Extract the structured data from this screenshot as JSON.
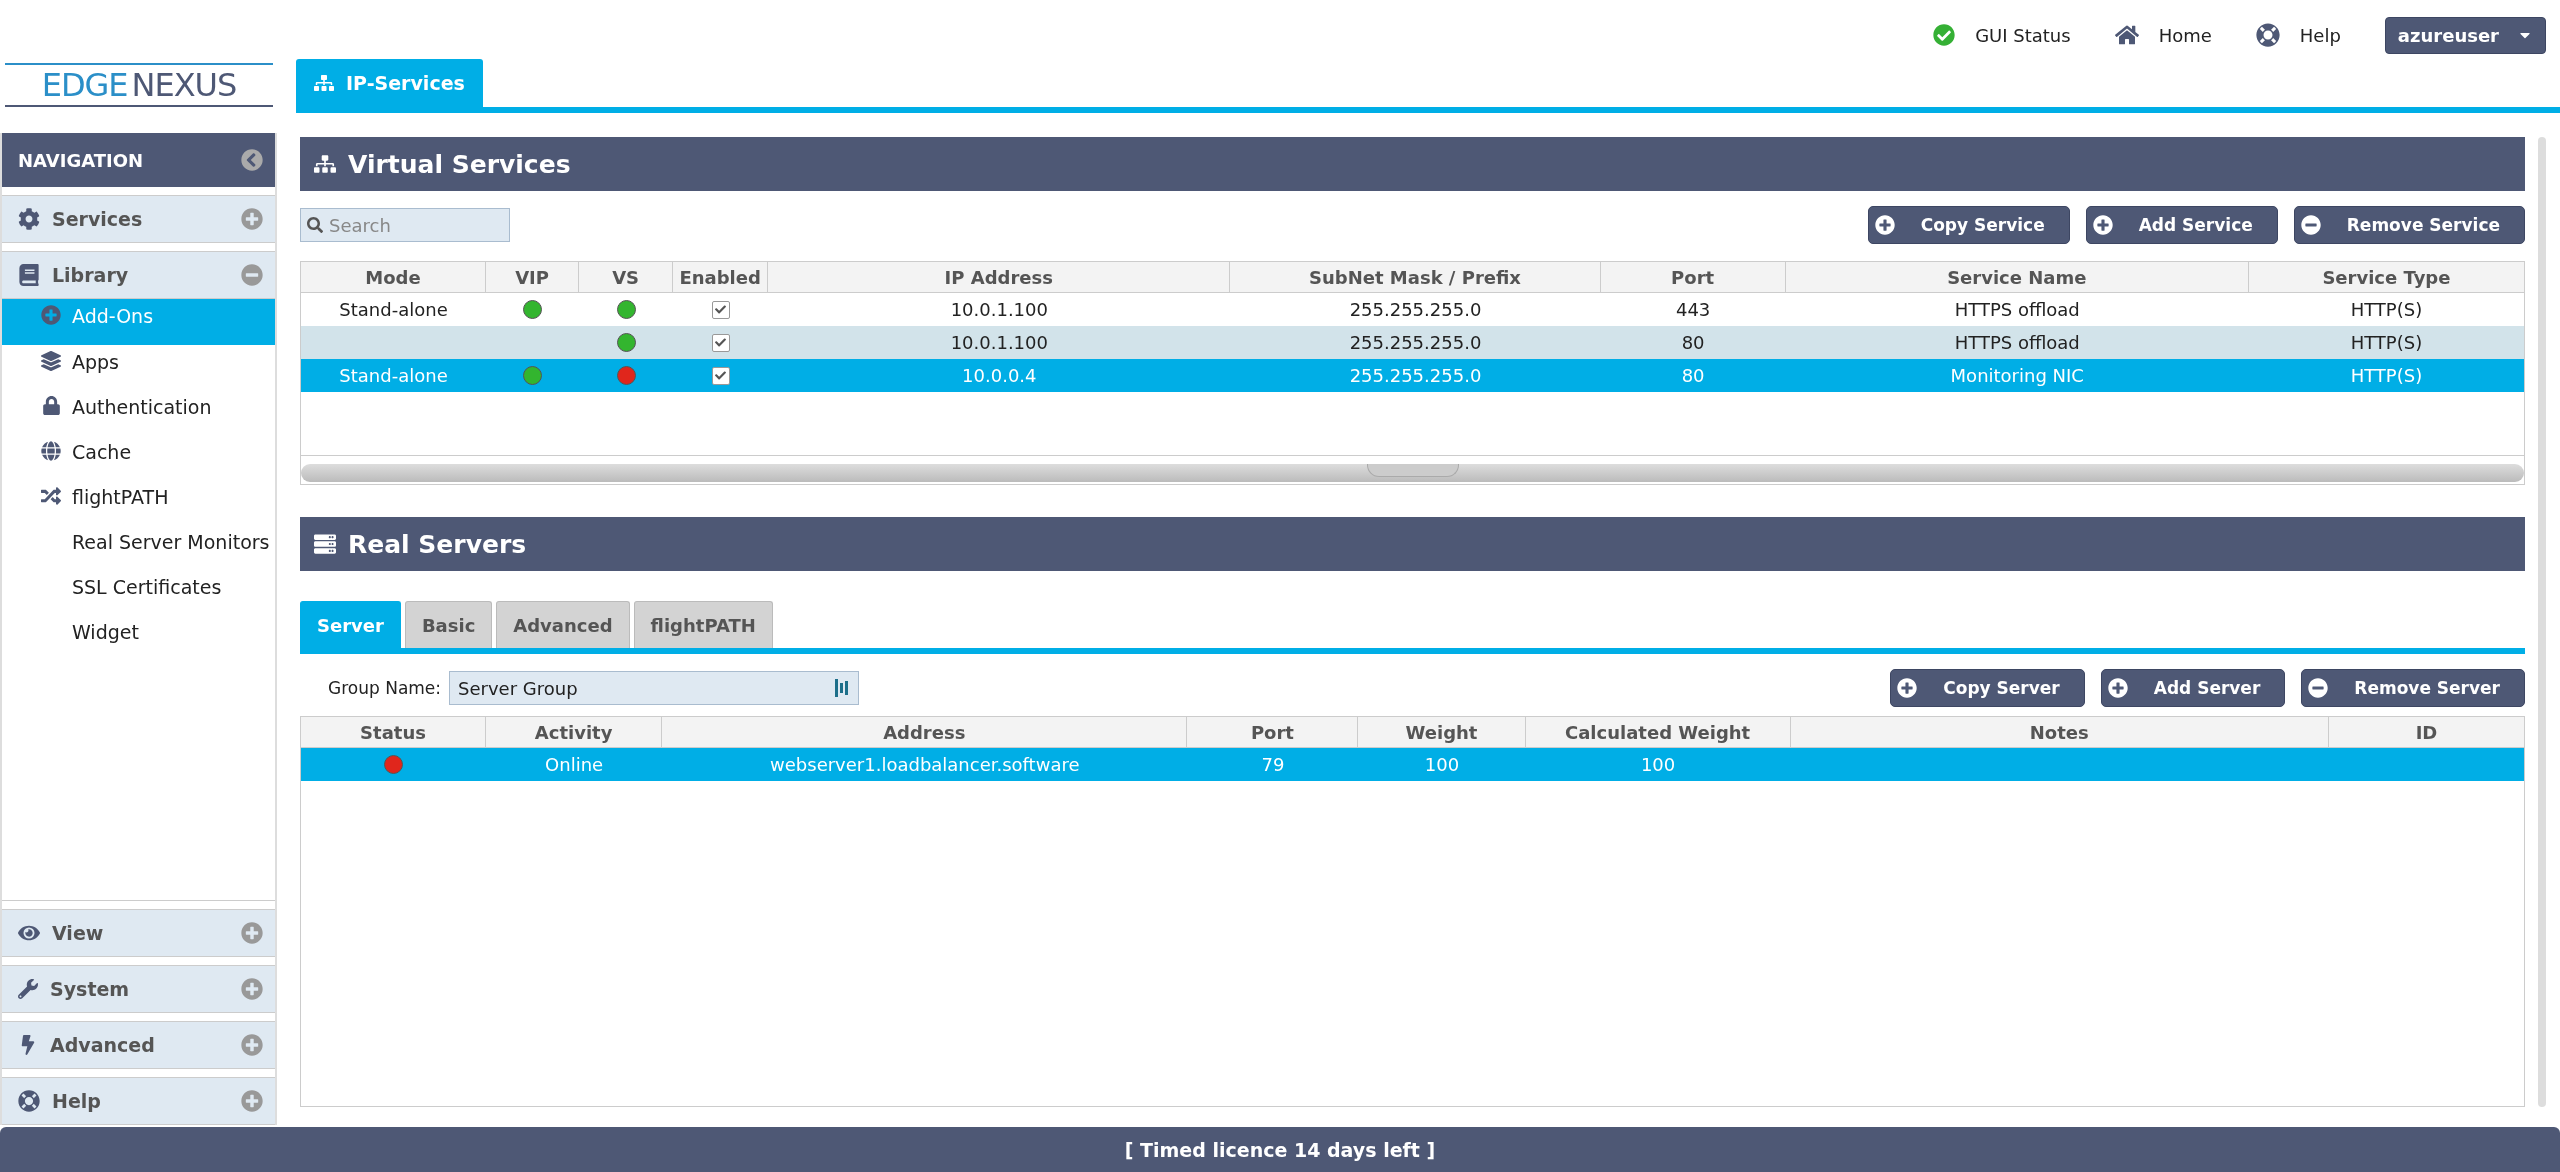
{
  "header": {
    "logo": [
      "EDGE",
      "NEXUS"
    ],
    "tab": {
      "label": "IP-Services",
      "selected": true
    },
    "links": [
      {
        "label": "GUI Status"
      },
      {
        "label": "Home"
      },
      {
        "label": "Help"
      }
    ],
    "user": "azureuser"
  },
  "navigation": {
    "title": "NAVIGATION",
    "groups": [
      {
        "label": "Services",
        "expanded": false
      },
      {
        "label": "Library",
        "expanded": true,
        "children": [
          {
            "label": "Add-Ons",
            "selected": true
          },
          {
            "label": "Apps",
            "selected": false
          },
          {
            "label": "Authentication",
            "selected": false
          },
          {
            "label": "Cache",
            "selected": false
          },
          {
            "label": "flightPATH",
            "selected": false
          },
          {
            "label": "Real Server Monitors",
            "selected": false
          },
          {
            "label": "SSL Certificates",
            "selected": false
          },
          {
            "label": "Widget",
            "selected": false
          }
        ]
      },
      {
        "label": "View",
        "expanded": false
      },
      {
        "label": "System",
        "expanded": false
      },
      {
        "label": "Advanced",
        "expanded": false
      },
      {
        "label": "Help",
        "expanded": false
      }
    ]
  },
  "virtual_services": {
    "title": "Virtual Services",
    "search": {
      "placeholder": "Search"
    },
    "buttons": [
      {
        "label": "Copy Service",
        "kind": "add"
      },
      {
        "label": "Add Service",
        "kind": "add"
      },
      {
        "label": "Remove Service",
        "kind": "remove"
      }
    ],
    "columns": [
      "Mode",
      "VIP",
      "VS",
      "Enabled",
      "IP Address",
      "SubNet Mask / Prefix",
      "Port",
      "Service Name",
      "Service Type"
    ],
    "rows": [
      {
        "mode": "Stand-alone",
        "vip": {
          "color": "#33b52f"
        },
        "vs": {
          "color": "#33b52f"
        },
        "enabled": true,
        "ip": "10.0.1.100",
        "mask": "255.255.255.0",
        "port": "443",
        "service_name": "HTTPS offload",
        "service_type": "HTTP(S)",
        "selected": false
      },
      {
        "vs": {
          "color": "#33b52f"
        },
        "enabled": true,
        "ip": "10.0.1.100",
        "mask": "255.255.255.0",
        "port": "80",
        "service_name": "HTTPS offload",
        "service_type": "HTTP(S)",
        "selected": false
      },
      {
        "mode": "Stand-alone",
        "vip": {
          "color": "#33b52f"
        },
        "vs": {
          "color": "#e0261c"
        },
        "enabled": true,
        "ip": "10.0.0.4",
        "mask": "255.255.255.0",
        "port": "80",
        "service_name": "Monitoring NIC",
        "service_type": "HTTP(S)",
        "selected": true
      }
    ]
  },
  "real_servers": {
    "title": "Real Servers",
    "tabs": [
      {
        "label": "Server",
        "selected": true
      },
      {
        "label": "Basic",
        "selected": false
      },
      {
        "label": "Advanced",
        "selected": false
      },
      {
        "label": "flightPATH",
        "selected": false
      }
    ],
    "group_name": {
      "label": "Group Name:",
      "value": "Server Group"
    },
    "buttons": [
      {
        "label": "Copy Server",
        "kind": "add"
      },
      {
        "label": "Add Server",
        "kind": "add"
      },
      {
        "label": "Remove Server",
        "kind": "remove"
      }
    ],
    "columns": [
      "Status",
      "Activity",
      "Address",
      "Port",
      "Weight",
      "Calculated Weight",
      "Notes",
      "ID"
    ],
    "rows": [
      {
        "status": {
          "color": "#e0261c"
        },
        "activity": "Online",
        "address": "webserver1.loadbalancer.software",
        "port": "79",
        "weight": "100",
        "calculated_weight": "100",
        "selected": true
      }
    ]
  },
  "status_bar": "[ Timed licence 14 days left ]"
}
